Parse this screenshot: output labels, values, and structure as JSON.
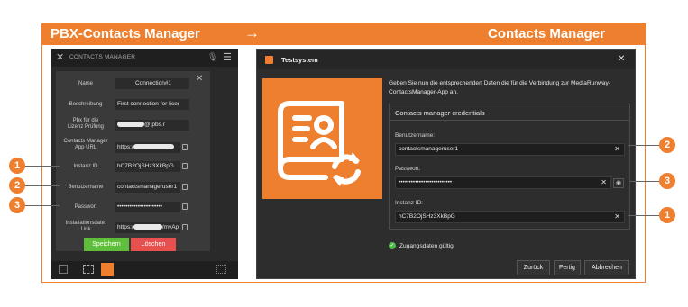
{
  "header": {
    "left_title": "PBX-Contacts Manager",
    "arrow": "→",
    "right_title": "Contacts Manager"
  },
  "left": {
    "window_title": "CONTACTS MANAGER",
    "fields": [
      {
        "label": "Name",
        "value": "Connection#1"
      },
      {
        "label": "Beschreibung",
        "value": "First connection for licer"
      },
      {
        "label": "Pbx für die\nLizenz Prüfung",
        "value": "@      pbs.r"
      },
      {
        "label": "Contacts Manager\nApp URL",
        "value": "https:/"
      },
      {
        "label": "Instanz ID",
        "value": "hC7B2OjSHz3XkBpG"
      },
      {
        "label": "Benutzername",
        "value": "contactsmanageruser1"
      },
      {
        "label": "Passwort",
        "value": "••••••••••••••••••••••"
      },
      {
        "label": "Installationsdatei\nLink",
        "value": "https:/"
      }
    ],
    "url_suffix": "/myAp",
    "save_label": "Speichern",
    "delete_label": "Löschen"
  },
  "badges": {
    "one": "1",
    "two": "2",
    "three": "3"
  },
  "right": {
    "dialog_title": "Testsystem",
    "intro": "Geben Sie nun die entsprechenden Daten die für die Verbindung zur MediaRunway-ContactsManager-App an.",
    "section_title": "Contacts manager credentials",
    "username_label": "Benutzername:",
    "username_value": "contactsmanageruser1",
    "password_label": "Passwort:",
    "password_value": "••••••••••••••••••••••••••",
    "instance_label": "Instanz ID:",
    "instance_value": "hC7B2OjSHz3XkBpG",
    "status": "Zugangsdaten gültig.",
    "back_label": "Zurück",
    "done_label": "Fertig",
    "cancel_label": "Abbrechen"
  },
  "colors": {
    "accent": "#ee7f2e",
    "save": "#5fbf3a",
    "delete": "#e85050",
    "valid": "#4cbb47"
  }
}
